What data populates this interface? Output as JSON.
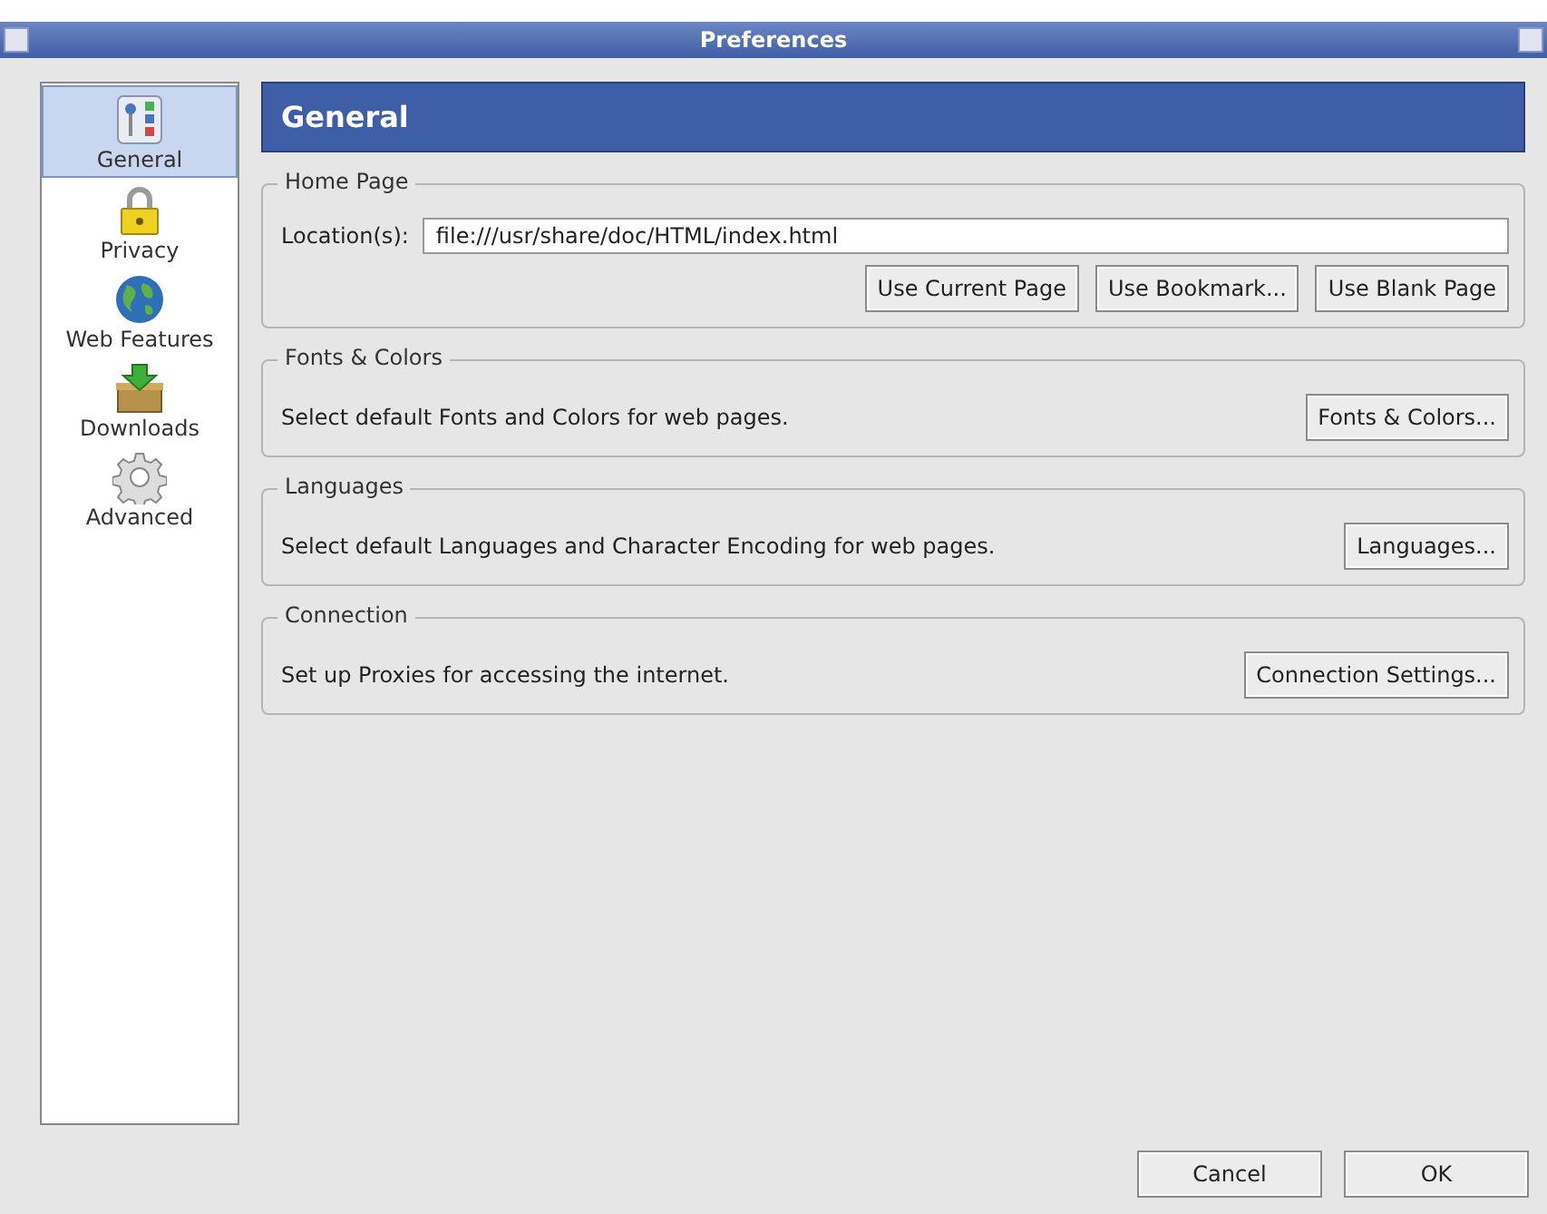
{
  "window": {
    "title": "Preferences"
  },
  "sidebar": {
    "items": [
      {
        "label": "General",
        "kind": "general",
        "selected": true
      },
      {
        "label": "Privacy",
        "kind": "privacy",
        "selected": false
      },
      {
        "label": "Web Features",
        "kind": "web",
        "selected": false
      },
      {
        "label": "Downloads",
        "kind": "downloads",
        "selected": false
      },
      {
        "label": "Advanced",
        "kind": "advanced",
        "selected": false
      }
    ]
  },
  "panel": {
    "title": "General",
    "groups": [
      {
        "title": "Home Page",
        "kind": "homepage",
        "field_label": "Location(s):",
        "value": "file:///usr/share/doc/HTML/index.html",
        "buttons": [
          "Use Current Page",
          "Use Bookmark...",
          "Use Blank Page"
        ]
      },
      {
        "title": "Fonts & Colors",
        "kind": "simple",
        "text": "Select default Fonts and Colors for web pages.",
        "buttons": [
          "Fonts & Colors..."
        ]
      },
      {
        "title": "Languages",
        "kind": "simple",
        "text": "Select default Languages and Character Encoding for web pages.",
        "buttons": [
          "Languages..."
        ]
      },
      {
        "title": "Connection",
        "kind": "simple",
        "text": "Set up Proxies for accessing the internet.",
        "buttons": [
          "Connection Settings..."
        ]
      }
    ]
  },
  "buttons": [
    "Cancel",
    "OK"
  ]
}
